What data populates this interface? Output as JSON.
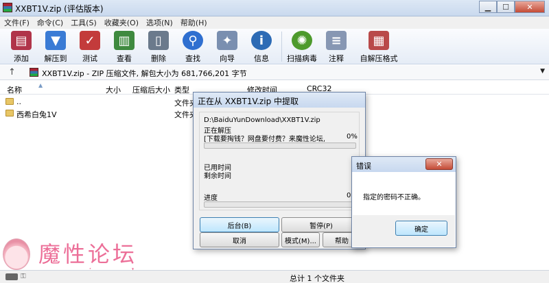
{
  "window": {
    "title": "XXBT1V.zip (评估版本)"
  },
  "menu": [
    "文件(F)",
    "命令(C)",
    "工具(S)",
    "收藏夹(O)",
    "选项(N)",
    "帮助(H)"
  ],
  "toolbar": [
    {
      "label": "添加",
      "icon": "add-archive-icon",
      "color": "#b0344a"
    },
    {
      "label": "解压到",
      "icon": "extract-folder-icon",
      "color": "#3a7bd5"
    },
    {
      "label": "测试",
      "icon": "test-clipboard-icon",
      "color": "#c33b3b"
    },
    {
      "label": "查看",
      "icon": "view-book-icon",
      "color": "#3f8a3f"
    },
    {
      "label": "删除",
      "icon": "trash-icon",
      "color": "#6b7a8c"
    },
    {
      "label": "查找",
      "icon": "magnifier-icon",
      "color": "#2f6fd0"
    },
    {
      "label": "向导",
      "icon": "wizard-wand-icon",
      "color": "#7a8fb0"
    },
    {
      "label": "信息",
      "icon": "info-icon",
      "color": "#2d6bb5"
    },
    {
      "label": "扫描病毒",
      "icon": "virus-scan-icon",
      "color": "#4d9a2c"
    },
    {
      "label": "注释",
      "icon": "comment-icon",
      "color": "#8797b3"
    },
    {
      "label": "自解压格式",
      "icon": "sfx-archive-icon",
      "color": "#b94a4a"
    }
  ],
  "address": {
    "text": "XXBT1V.zip - ZIP 压缩文件, 解包大小为 681,766,201 字节"
  },
  "columns": {
    "name": "名称",
    "size": "大小",
    "packed": "压缩后大小",
    "type": "类型",
    "modified": "修改时间",
    "crc": "CRC32"
  },
  "rows": [
    {
      "name": "..",
      "type": "文件夹"
    },
    {
      "name": "西希白兔1V",
      "type": "文件夹"
    }
  ],
  "status": {
    "text": "总计 1 个文件夹"
  },
  "watermark": {
    "title": "魔性论坛",
    "url": "www.moxing.cool"
  },
  "extract_dialog": {
    "title": "正在从 XXBT1V.zip 中提取",
    "path": "D:\\BaiduYunDownload\\XXBT1V.zip",
    "status": "正在解压",
    "file": "[下载要掏钱？网盘要付费？来魔性论坛,",
    "file_percent": "0%",
    "elapsed_label": "已用时间",
    "remaining_label": "剩余时间",
    "progress_label": "进度",
    "progress_percent": "0%",
    "progress_value": 0,
    "buttons": {
      "background": "后台(B)",
      "pause": "暂停(P)",
      "cancel": "取消",
      "mode": "模式(M)...",
      "help": "帮助"
    }
  },
  "error_dialog": {
    "title": "错误",
    "message": "指定的密码不正确。",
    "ok": "确定"
  }
}
